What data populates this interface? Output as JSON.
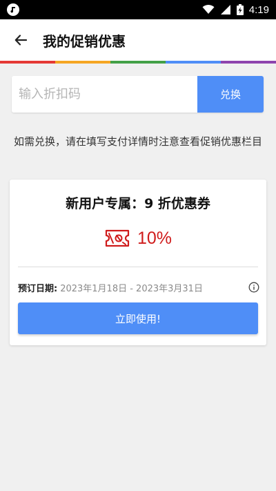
{
  "status_bar": {
    "time": "4:19",
    "icons": [
      "app-notification-icon",
      "wifi-icon",
      "signal-icon",
      "battery-charging-icon"
    ]
  },
  "header": {
    "back_icon": "arrow-left-icon",
    "title": "我的促销优惠",
    "rainbow_colors": [
      "#e53935",
      "#f5a623",
      "#43a047",
      "#4f8ef7",
      "#8e44ad"
    ]
  },
  "promo": {
    "placeholder": "输入折扣码",
    "value": "",
    "redeem_label": "兑换"
  },
  "notice": "如需兑换，请在填写支付详情时注意查看促销优惠栏目",
  "coupon": {
    "title": "新用户专属：9 折优惠券",
    "icon": "coupon-ticket-icon",
    "discount": "10%",
    "booking_label": "预订日期:",
    "booking_dates": "2023年1月18日 - 2023年3月31日",
    "info_icon": "info-icon",
    "use_label": "立即使用!"
  },
  "colors": {
    "accent": "#4f8ef7",
    "discount_red": "#cf1b1b",
    "background": "#f0f0f0"
  }
}
